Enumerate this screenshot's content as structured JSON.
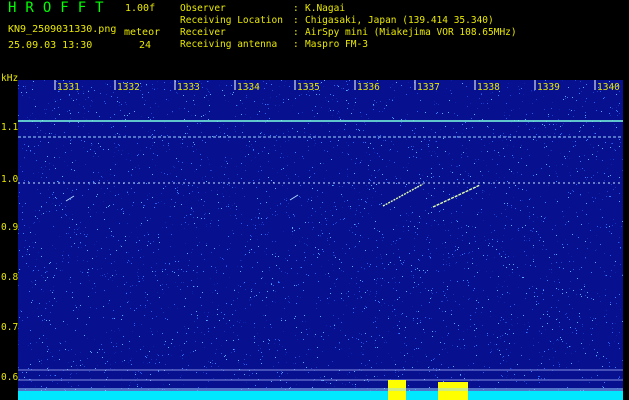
{
  "header": {
    "app_title": "HROFFT",
    "app_version": "1.00f",
    "file_name": "KN9_2509031330.png",
    "meteor_label": "meteor",
    "date_time": "25.09.03 13:30",
    "meteor_count": "24"
  },
  "metadata": [
    {
      "key": "Observer",
      "value": "K.Nagai"
    },
    {
      "key": "Receiving Location",
      "value": "Chigasaki, Japan (139.414 35.340)"
    },
    {
      "key": "Receiver",
      "value": "AirSpy mini (Miakejima VOR 108.65MHz)"
    },
    {
      "key": "Receiving antenna",
      "value": "Maspro FM-3"
    }
  ],
  "spectrogram": {
    "y_unit": "kHz",
    "y_ticks": [
      "1.1",
      "1.0",
      "0.9",
      "0.8",
      "0.7",
      "0.6"
    ],
    "x_ticks": [
      "1331",
      "1332",
      "1333",
      "1334",
      "1335",
      "1336",
      "1337",
      "1338",
      "1339",
      "1340"
    ],
    "colors": {
      "background": "#07108e",
      "text": "#e8e800",
      "title": "#00ff00",
      "noise_band": "#00e8ff",
      "burst": "#ffff00"
    }
  }
}
